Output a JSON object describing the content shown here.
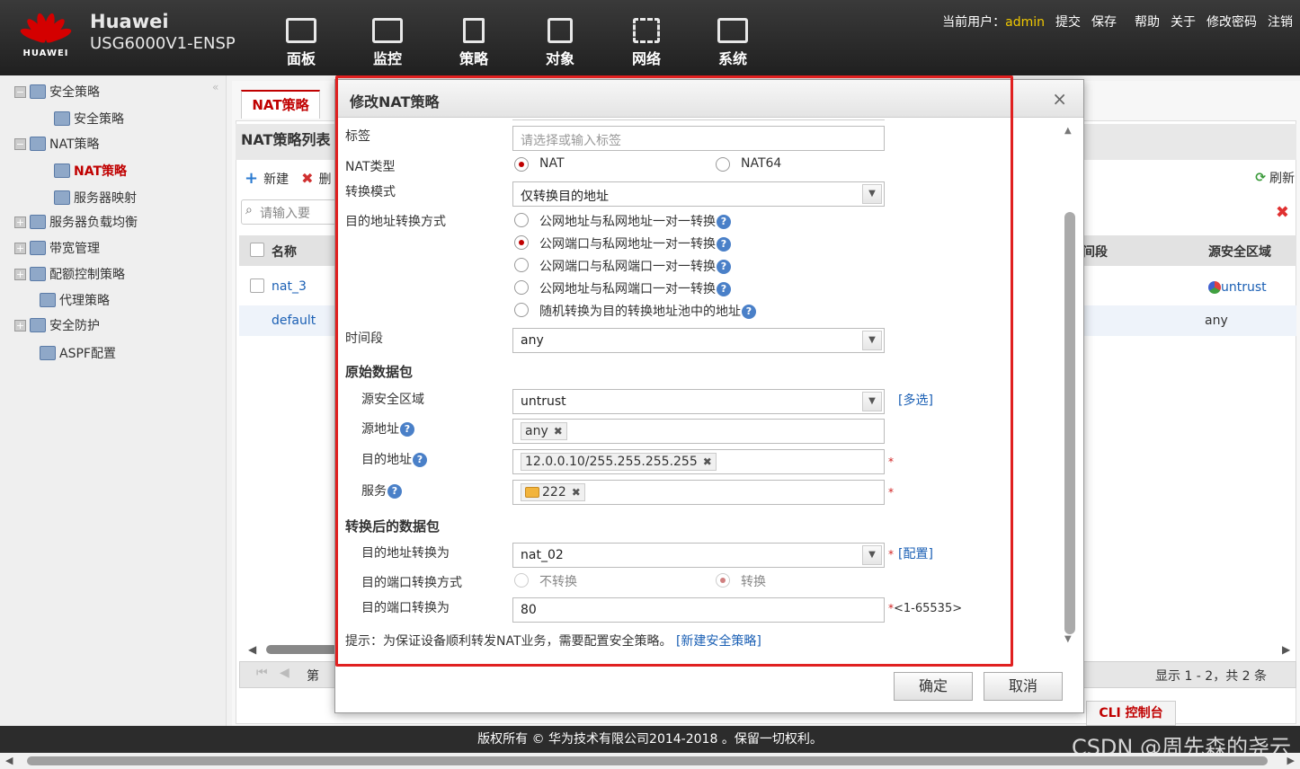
{
  "header": {
    "logo_text": "HUAWEI",
    "brand": "Huawei",
    "model": "USG6000V1-ENSP",
    "nav": [
      "面板",
      "监控",
      "策略",
      "对象",
      "网络",
      "系统"
    ],
    "current_user_label": "当前用户：",
    "current_user": "admin",
    "links": [
      "提交",
      "保存",
      "帮助",
      "关于",
      "修改密码",
      "注销"
    ]
  },
  "sidebar": {
    "items": [
      {
        "label": "安全策略"
      },
      {
        "label": "安全策略"
      },
      {
        "label": "NAT策略"
      },
      {
        "label": "NAT策略"
      },
      {
        "label": "服务器映射"
      },
      {
        "label": "服务器负载均衡"
      },
      {
        "label": "带宽管理"
      },
      {
        "label": "配额控制策略"
      },
      {
        "label": "代理策略"
      },
      {
        "label": "安全防护"
      },
      {
        "label": "ASPF配置"
      }
    ]
  },
  "list": {
    "tab": "NAT策略",
    "title": "NAT策略列表",
    "new_label": "新建",
    "delete_label": "删",
    "refresh_label": "刷新",
    "search_placeholder": "请输入要",
    "col_name": "名称",
    "col_time": "间段",
    "col_src_zone": "源安全区域",
    "rows": [
      {
        "name": "nat_3",
        "src_zone": "untrust"
      },
      {
        "name": "default",
        "src_zone": "any"
      }
    ],
    "pager_label": "第",
    "summary": "显示 1 - 2，共 2 条",
    "cli": "CLI 控制台"
  },
  "modal": {
    "title": "修改NAT策略",
    "label_tag": "标签",
    "tag_placeholder": "请选择或输入标签",
    "label_nat_type": "NAT类型",
    "nat_type_options": [
      "NAT",
      "NAT64"
    ],
    "label_mode": "转换模式",
    "mode_value": "仅转换目的地址",
    "label_dst_method": "目的地址转换方式",
    "dst_methods": [
      "公网地址与私网地址一对一转换",
      "公网端口与私网地址一对一转换",
      "公网端口与私网端口一对一转换",
      "公网地址与私网端口一对一转换",
      "随机转换为目的转换地址池中的地址"
    ],
    "label_time": "时间段",
    "time_value": "any",
    "section_orig": "原始数据包",
    "label_src_zone": "源安全区域",
    "src_zone_value": "untrust",
    "multi_select": "[多选]",
    "label_src_addr": "源地址",
    "src_addr_chip": "any",
    "label_dst_addr": "目的地址",
    "dst_addr_chip": "12.0.0.10/255.255.255.255",
    "label_service": "服务",
    "service_chip": "222",
    "section_after": "转换后的数据包",
    "label_dst_to": "目的地址转换为",
    "dst_to_value": "nat_02",
    "config_link": "[配置]",
    "label_port_method": "目的端口转换方式",
    "port_methods": [
      "不转换",
      "转换"
    ],
    "label_port_to": "目的端口转换为",
    "port_to_value": "80",
    "port_range": "<1-65535>",
    "tip": "提示：为保证设备顺利转发NAT业务，需要配置安全策略。",
    "tip_link": "[新建安全策略]",
    "ok": "确定",
    "cancel": "取消",
    "required_mark": "*"
  },
  "footer": {
    "copyright": "版权所有 © 华为技术有限公司2014-2018 。保留一切权利。",
    "watermark": "CSDN @周先森的尧云"
  },
  "colors": {
    "accent_red": "#c00000",
    "link_blue": "#1a5fb4",
    "highlight_frame": "#e02020"
  }
}
